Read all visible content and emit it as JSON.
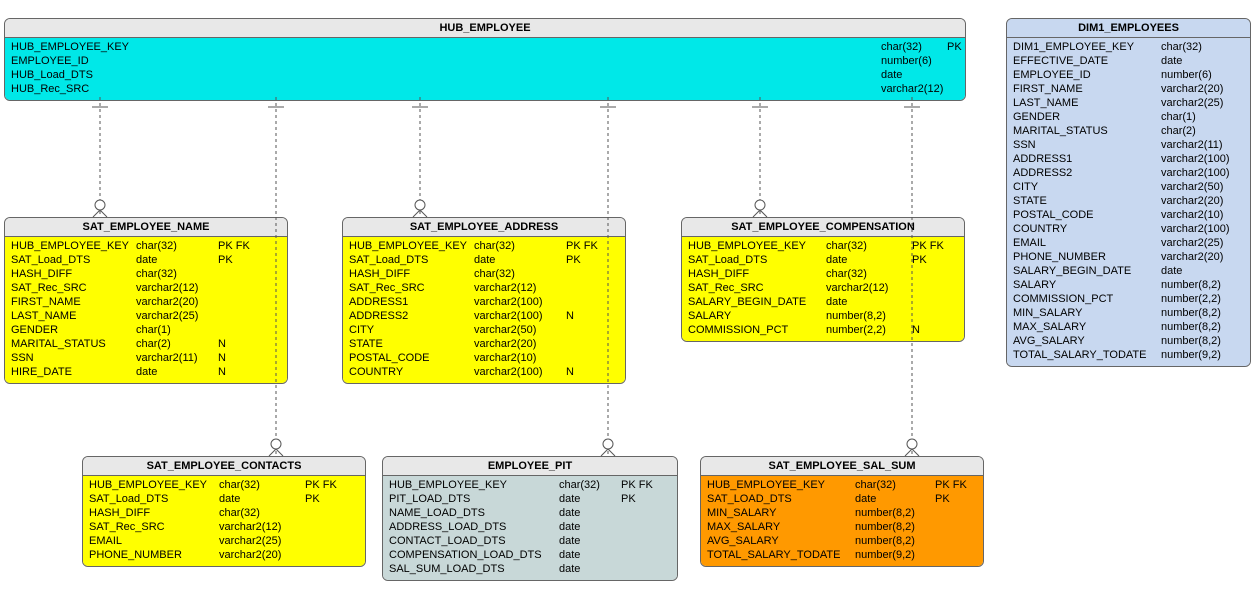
{
  "hub": {
    "title": "HUB_EMPLOYEE",
    "rows": [
      {
        "name": "HUB_EMPLOYEE_KEY",
        "type": "char(32)",
        "key": "PK"
      },
      {
        "name": "EMPLOYEE_ID",
        "type": "number(6)",
        "key": ""
      },
      {
        "name": "HUB_Load_DTS",
        "type": "date",
        "key": ""
      },
      {
        "name": "HUB_Rec_SRC",
        "type": "varchar2(12)",
        "key": ""
      }
    ]
  },
  "sat_name": {
    "title": "SAT_EMPLOYEE_NAME",
    "rows": [
      {
        "name": "HUB_EMPLOYEE_KEY",
        "type": "char(32)",
        "key": "PK FK"
      },
      {
        "name": "SAT_Load_DTS",
        "type": "date",
        "key": "PK"
      },
      {
        "name": "HASH_DIFF",
        "type": "char(32)",
        "key": ""
      },
      {
        "name": "SAT_Rec_SRC",
        "type": "varchar2(12)",
        "key": ""
      },
      {
        "name": "FIRST_NAME",
        "type": "varchar2(20)",
        "key": ""
      },
      {
        "name": "LAST_NAME",
        "type": "varchar2(25)",
        "key": ""
      },
      {
        "name": "GENDER",
        "type": "char(1)",
        "key": ""
      },
      {
        "name": "MARITAL_STATUS",
        "type": "char(2)",
        "key": "N"
      },
      {
        "name": "SSN",
        "type": "varchar2(11)",
        "key": "N"
      },
      {
        "name": "HIRE_DATE",
        "type": "date",
        "key": "N"
      }
    ]
  },
  "sat_address": {
    "title": "SAT_EMPLOYEE_ADDRESS",
    "rows": [
      {
        "name": "HUB_EMPLOYEE_KEY",
        "type": "char(32)",
        "key": "PK FK"
      },
      {
        "name": "SAT_Load_DTS",
        "type": "date",
        "key": "PK"
      },
      {
        "name": "HASH_DIFF",
        "type": "char(32)",
        "key": ""
      },
      {
        "name": "SAT_Rec_SRC",
        "type": "varchar2(12)",
        "key": ""
      },
      {
        "name": "ADDRESS1",
        "type": "varchar2(100)",
        "key": ""
      },
      {
        "name": "ADDRESS2",
        "type": "varchar2(100)",
        "key": "N"
      },
      {
        "name": "CITY",
        "type": "varchar2(50)",
        "key": ""
      },
      {
        "name": "STATE",
        "type": "varchar2(20)",
        "key": ""
      },
      {
        "name": "POSTAL_CODE",
        "type": "varchar2(10)",
        "key": ""
      },
      {
        "name": "COUNTRY",
        "type": "varchar2(100)",
        "key": "N"
      }
    ]
  },
  "sat_comp": {
    "title": "SAT_EMPLOYEE_COMPENSATION",
    "rows": [
      {
        "name": "HUB_EMPLOYEE_KEY",
        "type": "char(32)",
        "key": "PK FK"
      },
      {
        "name": "SAT_Load_DTS",
        "type": "date",
        "key": "PK"
      },
      {
        "name": "HASH_DIFF",
        "type": "char(32)",
        "key": ""
      },
      {
        "name": "SAT_Rec_SRC",
        "type": "varchar2(12)",
        "key": ""
      },
      {
        "name": "SALARY_BEGIN_DATE",
        "type": "date",
        "key": ""
      },
      {
        "name": "SALARY",
        "type": "number(8,2)",
        "key": ""
      },
      {
        "name": "COMMISSION_PCT",
        "type": "number(2,2)",
        "key": "N"
      }
    ]
  },
  "sat_contacts": {
    "title": "SAT_EMPLOYEE_CONTACTS",
    "rows": [
      {
        "name": "HUB_EMPLOYEE_KEY",
        "type": "char(32)",
        "key": "PK FK"
      },
      {
        "name": "SAT_Load_DTS",
        "type": "date",
        "key": "PK"
      },
      {
        "name": "HASH_DIFF",
        "type": "char(32)",
        "key": ""
      },
      {
        "name": "SAT_Rec_SRC",
        "type": "varchar2(12)",
        "key": ""
      },
      {
        "name": "EMAIL",
        "type": "varchar2(25)",
        "key": ""
      },
      {
        "name": "PHONE_NUMBER",
        "type": "varchar2(20)",
        "key": ""
      }
    ]
  },
  "pit": {
    "title": "EMPLOYEE_PIT",
    "rows": [
      {
        "name": "HUB_EMPLOYEE_KEY",
        "type": "char(32)",
        "key": "PK FK"
      },
      {
        "name": "PIT_LOAD_DTS",
        "type": "date",
        "key": "PK"
      },
      {
        "name": "NAME_LOAD_DTS",
        "type": "date",
        "key": ""
      },
      {
        "name": "ADDRESS_LOAD_DTS",
        "type": "date",
        "key": ""
      },
      {
        "name": "CONTACT_LOAD_DTS",
        "type": "date",
        "key": ""
      },
      {
        "name": "COMPENSATION_LOAD_DTS",
        "type": "date",
        "key": ""
      },
      {
        "name": "SAL_SUM_LOAD_DTS",
        "type": "date",
        "key": ""
      }
    ]
  },
  "sat_salsum": {
    "title": "SAT_EMPLOYEE_SAL_SUM",
    "rows": [
      {
        "name": "HUB_EMPLOYEE_KEY",
        "type": "char(32)",
        "key": "PK FK"
      },
      {
        "name": "SAT_LOAD_DTS",
        "type": "date",
        "key": "PK"
      },
      {
        "name": "MIN_SALARY",
        "type": "number(8,2)",
        "key": ""
      },
      {
        "name": "MAX_SALARY",
        "type": "number(8,2)",
        "key": ""
      },
      {
        "name": "AVG_SALARY",
        "type": "number(8,2)",
        "key": ""
      },
      {
        "name": "TOTAL_SALARY_TODATE",
        "type": "number(9,2)",
        "key": ""
      }
    ]
  },
  "dim": {
    "title": "DIM1_EMPLOYEES",
    "rows": [
      {
        "name": "DIM1_EMPLOYEE_KEY",
        "type": "char(32)",
        "key": ""
      },
      {
        "name": "EFFECTIVE_DATE",
        "type": "date",
        "key": ""
      },
      {
        "name": "EMPLOYEE_ID",
        "type": "number(6)",
        "key": ""
      },
      {
        "name": "FIRST_NAME",
        "type": "varchar2(20)",
        "key": ""
      },
      {
        "name": "LAST_NAME",
        "type": "varchar2(25)",
        "key": ""
      },
      {
        "name": "GENDER",
        "type": "char(1)",
        "key": ""
      },
      {
        "name": "MARITAL_STATUS",
        "type": "char(2)",
        "key": ""
      },
      {
        "name": "SSN",
        "type": "varchar2(11)",
        "key": ""
      },
      {
        "name": "ADDRESS1",
        "type": "varchar2(100)",
        "key": ""
      },
      {
        "name": "ADDRESS2",
        "type": "varchar2(100)",
        "key": ""
      },
      {
        "name": "CITY",
        "type": "varchar2(50)",
        "key": ""
      },
      {
        "name": "STATE",
        "type": "varchar2(20)",
        "key": ""
      },
      {
        "name": "POSTAL_CODE",
        "type": "varchar2(10)",
        "key": ""
      },
      {
        "name": "COUNTRY",
        "type": "varchar2(100)",
        "key": ""
      },
      {
        "name": "EMAIL",
        "type": "varchar2(25)",
        "key": ""
      },
      {
        "name": "PHONE_NUMBER",
        "type": "varchar2(20)",
        "key": ""
      },
      {
        "name": "SALARY_BEGIN_DATE",
        "type": "date",
        "key": ""
      },
      {
        "name": "SALARY",
        "type": "number(8,2)",
        "key": ""
      },
      {
        "name": "COMMISSION_PCT",
        "type": "number(2,2)",
        "key": ""
      },
      {
        "name": "MIN_SALARY",
        "type": "number(8,2)",
        "key": ""
      },
      {
        "name": "MAX_SALARY",
        "type": "number(8,2)",
        "key": ""
      },
      {
        "name": "AVG_SALARY",
        "type": "number(8,2)",
        "key": ""
      },
      {
        "name": "TOTAL_SALARY_TODATE",
        "type": "number(9,2)",
        "key": ""
      }
    ]
  },
  "colors": {
    "hub_title": "#e8e8e8",
    "hub_body": "#00e8e8",
    "sat_title": "#e8e8e8",
    "sat_body": "#ffff00",
    "pit_title": "#e8e8e8",
    "pit_body": "#c8d8d8",
    "salsum_body": "#ff9900",
    "dim_title": "#c8d8f0",
    "dim_body": "#c8d8f0"
  }
}
